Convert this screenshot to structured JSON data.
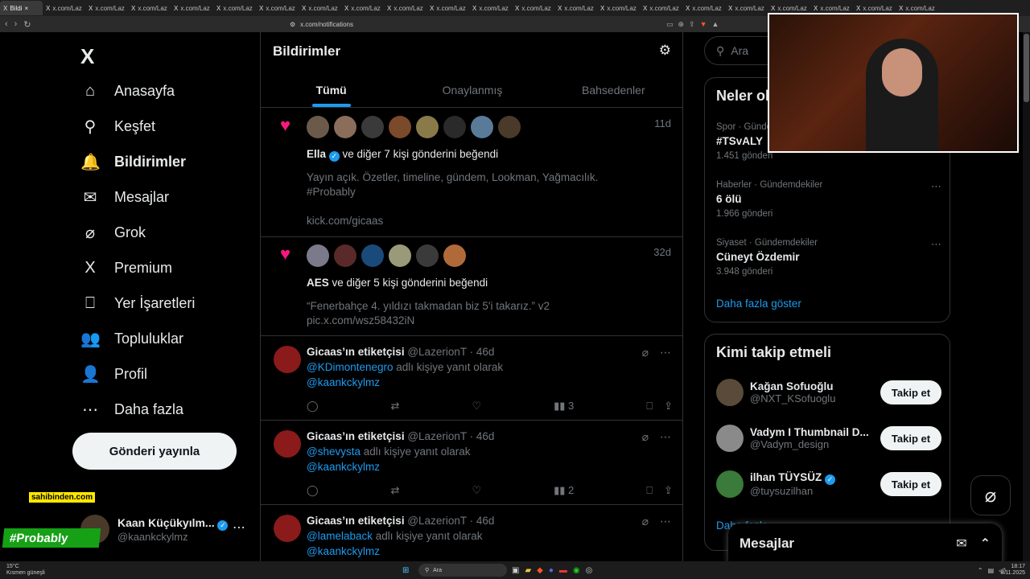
{
  "browser": {
    "tabs": [
      {
        "title": "Bildi"
      },
      {
        "title": "x.com/Laz"
      },
      {
        "title": "x.com/Laz"
      },
      {
        "title": "x.com/Laz"
      },
      {
        "title": "x.com/Laz"
      },
      {
        "title": "x.com/Laz"
      },
      {
        "title": "x.com/Laz"
      },
      {
        "title": "x.com/Laz"
      },
      {
        "title": "x.com/Laz"
      },
      {
        "title": "x.com/Laz"
      },
      {
        "title": "x.com/Laz"
      },
      {
        "title": "x.com/Laz"
      },
      {
        "title": "x.com/Laz"
      },
      {
        "title": "x.com/Laz"
      },
      {
        "title": "x.com/Laz"
      },
      {
        "title": "x.com/Laz"
      },
      {
        "title": "x.com/Laz"
      },
      {
        "title": "x.com/Laz"
      },
      {
        "title": "x.com/Laz"
      },
      {
        "title": "x.com/Laz"
      },
      {
        "title": "x.com/Laz"
      },
      {
        "title": "x.com/Laz"
      }
    ],
    "url": "x.com/notifications"
  },
  "sidebar": {
    "logo": "X",
    "items": [
      {
        "label": "Anasayfa",
        "icon": "home-icon",
        "glyph": "⌂"
      },
      {
        "label": "Keşfet",
        "icon": "search-icon",
        "glyph": "⚲"
      },
      {
        "label": "Bildirimler",
        "icon": "bell-icon",
        "glyph": "🔔"
      },
      {
        "label": "Mesajlar",
        "icon": "mail-icon",
        "glyph": "✉"
      },
      {
        "label": "Grok",
        "icon": "grok-icon",
        "glyph": "⌀"
      },
      {
        "label": "Premium",
        "icon": "x-premium-icon",
        "glyph": "X"
      },
      {
        "label": "Yer İşaretleri",
        "icon": "bookmark-icon",
        "glyph": "⎕"
      },
      {
        "label": "Topluluklar",
        "icon": "communities-icon",
        "glyph": "👥"
      },
      {
        "label": "Profil",
        "icon": "profile-icon",
        "glyph": "👤"
      },
      {
        "label": "Daha fazla",
        "icon": "more-circle-icon",
        "glyph": "⋯"
      }
    ],
    "post_button": "Gönderi yayınla",
    "account": {
      "name": "Kaan Küçükyılm...",
      "handle": "@kaankckylmz"
    }
  },
  "overlay": {
    "sponsor": "sahibinden.com",
    "hashtag": "#Probably"
  },
  "main": {
    "title": "Bildirimler",
    "tabs": [
      "Tümü",
      "Onaylanmış",
      "Bahsedenler"
    ],
    "likes": [
      {
        "time": "11d",
        "who": "Ella",
        "rest": " ve diğer 7 kişi gönderini beğendi",
        "lines": [
          "Yayın açık. Özetler, timeline, gündem, Lookman, Yağmacılık.",
          "#Probably",
          "",
          "kick.com/gicaas"
        ],
        "avatars": [
          "#6b5a4a",
          "#8a6d5a",
          "#3a3a3a",
          "#7a4a2a",
          "#8a7a4a",
          "#2a2a2a",
          "#5a7a9a",
          "#4a3a2a"
        ]
      },
      {
        "time": "32d",
        "who": "AES",
        "rest": " ve diğer 5 kişi gönderini beğendi",
        "lines": [
          "“Fenerbahçe 4. yıldızı takmadan biz 5'i takarız.” v2",
          "pic.x.com/wsz58432iN"
        ],
        "avatars": [
          "#7a7a8a",
          "#5a2a2a",
          "#1a4a7a",
          "#9a9a7a",
          "#3a3a3a",
          "#b06a3a"
        ]
      }
    ],
    "replies": [
      {
        "name": "Gicaas’ın etiketçisi",
        "handle": "@LazerionT",
        "time": "46d",
        "mention": "@KDimontenegro",
        "suffix": " adlı kişiye yanıt olarak",
        "mention2": "@kaankckylmz",
        "views": "3"
      },
      {
        "name": "Gicaas’ın etiketçisi",
        "handle": "@LazerionT",
        "time": "46d",
        "mention": "@shevysta",
        "suffix": " adlı kişiye yanıt olarak",
        "mention2": "@kaankckylmz",
        "views": "2"
      },
      {
        "name": "Gicaas’ın etiketçisi",
        "handle": "@LazerionT",
        "time": "46d",
        "mention": "@lamelaback",
        "suffix": " adlı kişiye yanıt olarak",
        "mention2": "@kaankckylmz",
        "views": ""
      }
    ]
  },
  "right": {
    "search_placeholder": "Ara",
    "trends_title": "Neler ol",
    "trends": [
      {
        "cat": "Spor · Günde",
        "title": "#TSvALY",
        "count": "1.451 gönderi"
      },
      {
        "cat": "Haberler · Gündemdekiler",
        "title": "6 ölü",
        "count": "1.966 gönderi"
      },
      {
        "cat": "Siyaset · Gündemdekiler",
        "title": "Cüneyt Özdemir",
        "count": "3.948 gönderi"
      }
    ],
    "show_more": "Daha fazla göster",
    "who_title": "Kimi takip etmeli",
    "who": [
      {
        "name": "Kağan Sofuoğlu",
        "handle": "@NXT_KSofuoglu",
        "verified": false,
        "color": "#5a4a3a"
      },
      {
        "name": "Vadym I Thumbnail D...",
        "handle": "@Vadym_design",
        "verified": false,
        "color": "#8a8a8a"
      },
      {
        "name": "ilhan TÜYSÜZ",
        "handle": "@tuysuzilhan",
        "verified": true,
        "color": "#3a7a3a"
      }
    ],
    "follow_label": "Takip et",
    "who_more": "Daha fazla",
    "messages": "Mesajlar"
  },
  "taskbar": {
    "weather_temp": "15°C",
    "weather_desc": "Kısmen güneşli",
    "search": "Ara",
    "time": "18:17",
    "date": "8.11.2025"
  },
  "colors": {
    "accent": "#1d9bf0",
    "like": "#f91880",
    "background": "#000000"
  }
}
